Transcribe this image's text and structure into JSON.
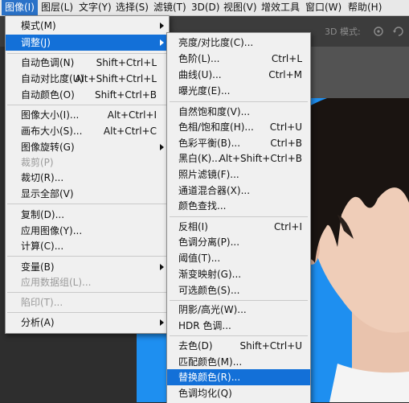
{
  "menubar": {
    "items": [
      "图像(I)",
      "图层(L)",
      "文字(Y)",
      "选择(S)",
      "滤镜(T)",
      "3D(D)",
      "视图(V)",
      "增效工具",
      "窗口(W)",
      "帮助(H)"
    ]
  },
  "options_bar": {
    "mode_label": "3D 模式:"
  },
  "image_menu": {
    "items": [
      {
        "label": "模式(M)",
        "submenu": true
      },
      {
        "label": "调整(J)",
        "submenu": true,
        "highlighted": true
      },
      {
        "label": "自动色调(N)",
        "shortcut": "Shift+Ctrl+L"
      },
      {
        "label": "自动对比度(U)",
        "shortcut": "Alt+Shift+Ctrl+L"
      },
      {
        "label": "自动颜色(O)",
        "shortcut": "Shift+Ctrl+B"
      },
      {
        "label": "图像大小(I)...",
        "shortcut": "Alt+Ctrl+I"
      },
      {
        "label": "画布大小(S)...",
        "shortcut": "Alt+Ctrl+C"
      },
      {
        "label": "图像旋转(G)",
        "submenu": true
      },
      {
        "label": "裁剪(P)",
        "disabled": true
      },
      {
        "label": "裁切(R)..."
      },
      {
        "label": "显示全部(V)"
      },
      {
        "label": "复制(D)..."
      },
      {
        "label": "应用图像(Y)..."
      },
      {
        "label": "计算(C)..."
      },
      {
        "label": "变量(B)",
        "submenu": true
      },
      {
        "label": "应用数据组(L)...",
        "disabled": true
      },
      {
        "label": "陷印(T)...",
        "disabled": true
      },
      {
        "label": "分析(A)",
        "submenu": true
      }
    ]
  },
  "adjust_menu": {
    "items": [
      {
        "label": "亮度/对比度(C)..."
      },
      {
        "label": "色阶(L)...",
        "shortcut": "Ctrl+L"
      },
      {
        "label": "曲线(U)...",
        "shortcut": "Ctrl+M"
      },
      {
        "label": "曝光度(E)..."
      },
      {
        "label": "自然饱和度(V)..."
      },
      {
        "label": "色相/饱和度(H)...",
        "shortcut": "Ctrl+U"
      },
      {
        "label": "色彩平衡(B)...",
        "shortcut": "Ctrl+B"
      },
      {
        "label": "黑白(K)...",
        "shortcut": "Alt+Shift+Ctrl+B"
      },
      {
        "label": "照片滤镜(F)..."
      },
      {
        "label": "通道混合器(X)..."
      },
      {
        "label": "颜色查找..."
      },
      {
        "label": "反相(I)",
        "shortcut": "Ctrl+I"
      },
      {
        "label": "色调分离(P)..."
      },
      {
        "label": "阈值(T)..."
      },
      {
        "label": "渐变映射(G)..."
      },
      {
        "label": "可选颜色(S)..."
      },
      {
        "label": "阴影/高光(W)..."
      },
      {
        "label": "HDR 色调..."
      },
      {
        "label": "去色(D)",
        "shortcut": "Shift+Ctrl+U"
      },
      {
        "label": "匹配颜色(M)..."
      },
      {
        "label": "替换颜色(R)...",
        "highlighted": true
      },
      {
        "label": "色调均化(Q)"
      }
    ]
  },
  "colors": {
    "accent": "#1370d8",
    "photo_background": "#1e8ff0"
  }
}
